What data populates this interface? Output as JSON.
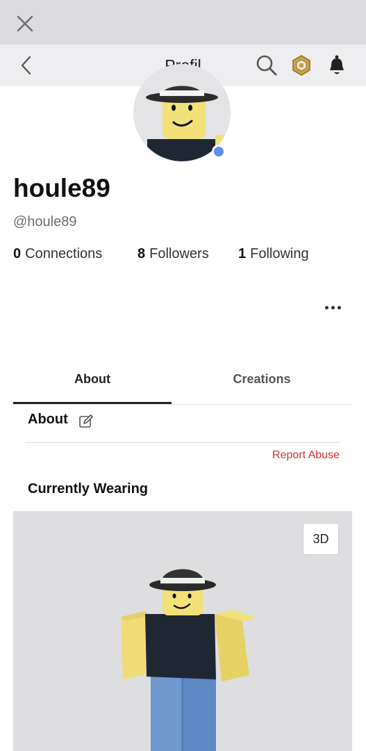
{
  "window": {
    "close_icon": "close-icon"
  },
  "nav": {
    "title": "Profil",
    "back_icon": "chevron-left-icon",
    "search_icon": "search-icon",
    "robux_icon": "robux-icon",
    "notifications_icon": "bell-icon"
  },
  "profile": {
    "display_name": "houle89",
    "username": "@houle89",
    "online_status_color": "#5b8ff0",
    "stats": [
      {
        "count": "0",
        "label": "Connections"
      },
      {
        "count": "8",
        "label": "Followers"
      },
      {
        "count": "1",
        "label": "Following"
      }
    ],
    "more_icon": "more-icon"
  },
  "tabs": [
    {
      "label": "About",
      "active": true
    },
    {
      "label": "Creations",
      "active": false
    }
  ],
  "about": {
    "heading": "About",
    "edit_icon": "edit-icon",
    "report_label": "Report Abuse"
  },
  "wearing": {
    "heading": "Currently Wearing",
    "view_toggle_label": "3D"
  },
  "colors": {
    "accent_red": "#d2312f",
    "avatar_yellow": "#f1e178",
    "shirt": "#1f2733",
    "pants": "#6f98cf"
  }
}
